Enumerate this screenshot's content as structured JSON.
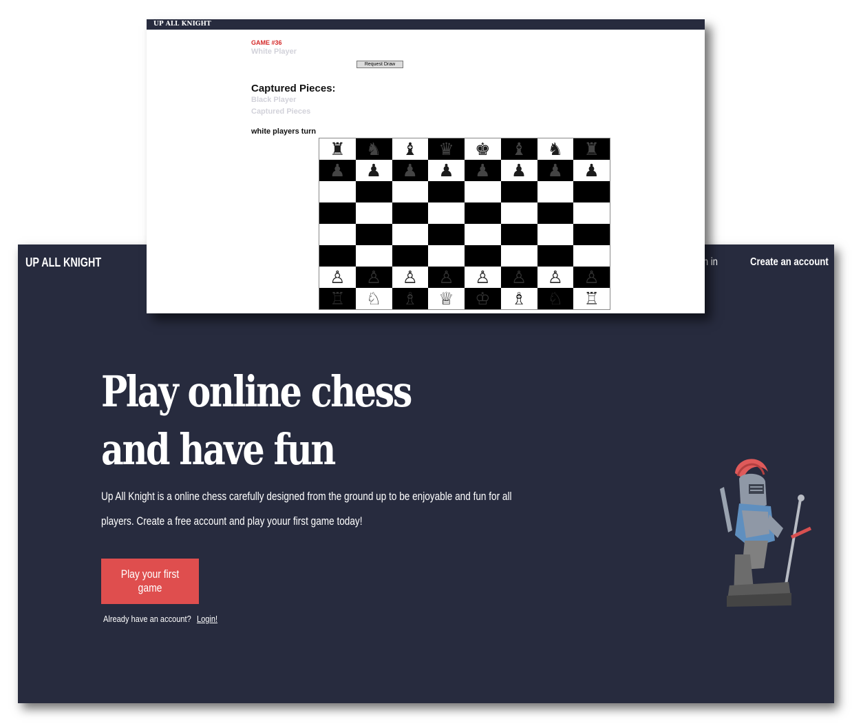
{
  "landing": {
    "brand": "UP ALL KNIGHT",
    "nav": {
      "sign_in": "Sign in",
      "create_account": "Create an account"
    },
    "hero_title": "Play online chess and have fun",
    "hero_description": "Up All Knight is a online chess carefully designed from the ground up to be enjoyable and fun for all players. Create a free account and play youur first game today!",
    "cta_label": "Play your first game",
    "login_prompt": "Already have an account?",
    "login_link": "Login!",
    "illustration": "knight-mascot-icon",
    "colors": {
      "background": "#272b3e",
      "accent": "#df4e4e",
      "text": "#ffffff"
    }
  },
  "game": {
    "brand": "UP ALL KNIGHT",
    "game_number": "GAME #36",
    "white_player_label": "White Player",
    "request_draw_label": "Request Draw",
    "captured_title": "Captured Pieces:",
    "black_player_label": "Black Player",
    "captured_pieces_label": "Captured Pieces",
    "turn_text": "white players turn",
    "colors": {
      "game_number": "#d42a2a",
      "faded_text": "#d2d2da"
    },
    "board": [
      [
        "♜",
        "♞",
        "♝",
        "♛",
        "♚",
        "♝",
        "♞",
        "♜"
      ],
      [
        "♟",
        "♟",
        "♟",
        "♟",
        "♟",
        "♟",
        "♟",
        "♟"
      ],
      [
        "",
        "",
        "",
        "",
        "",
        "",
        "",
        ""
      ],
      [
        "",
        "",
        "",
        "",
        "",
        "",
        "",
        ""
      ],
      [
        "",
        "",
        "",
        "",
        "",
        "",
        "",
        ""
      ],
      [
        "",
        "",
        "",
        "",
        "",
        "",
        "",
        ""
      ],
      [
        "♙",
        "♙",
        "♙",
        "♙",
        "♙",
        "♙",
        "♙",
        "♙"
      ],
      [
        "♖",
        "♘",
        "♗",
        "♕",
        "♔",
        "♗",
        "♘",
        "♖"
      ]
    ]
  }
}
